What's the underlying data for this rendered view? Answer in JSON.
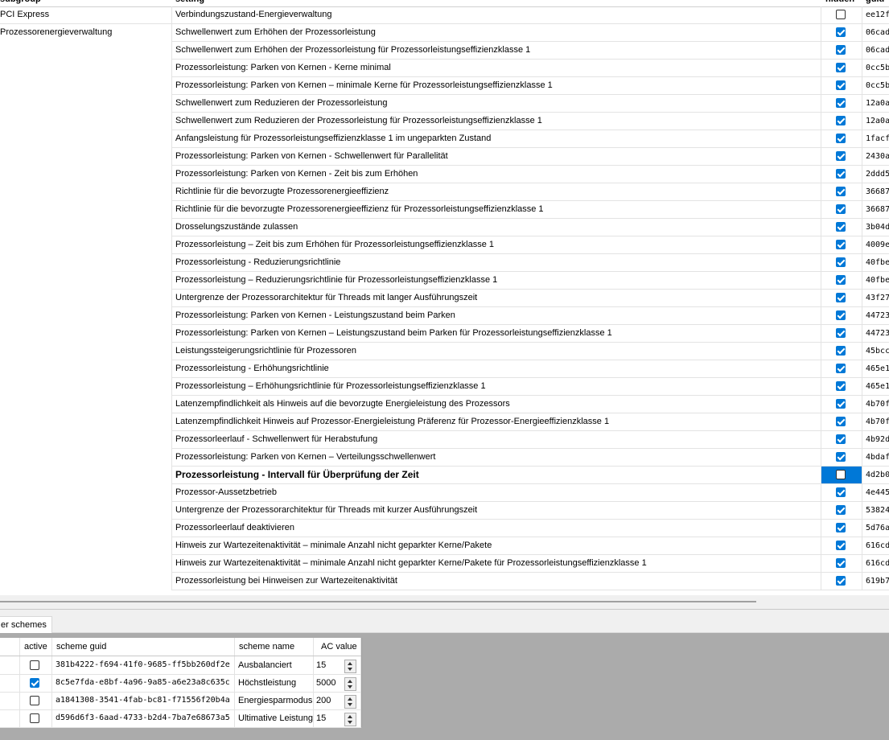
{
  "headers": {
    "subgroup": "subgroup",
    "setting": "setting",
    "hidden": "hidden",
    "guid": "guid"
  },
  "subgroups": [
    {
      "label": "PCI Express"
    },
    {
      "label": "Prozessorenergieverwaltung"
    }
  ],
  "rows": [
    {
      "setting": "Verbindungszustand-Energieverwaltung",
      "hidden": false,
      "guid": "ee12f"
    },
    {
      "setting": "Schwellenwert zum Erhöhen der Prozessorleistung",
      "hidden": true,
      "guid": "06cad"
    },
    {
      "setting": "Schwellenwert zum Erhöhen der Prozessorleistung für Prozessorleistungseffizienzklasse 1",
      "hidden": true,
      "guid": "06cad"
    },
    {
      "setting": "Prozessorleistung: Parken von Kernen - Kerne minimal",
      "hidden": true,
      "guid": "0cc5b"
    },
    {
      "setting": "Prozessorleistung: Parken von Kernen – minimale Kerne für Prozessorleistungseffizienzklasse 1",
      "hidden": true,
      "guid": "0cc5b"
    },
    {
      "setting": "Schwellenwert zum Reduzieren der Prozessorleistung",
      "hidden": true,
      "guid": "12a0a"
    },
    {
      "setting": "Schwellenwert zum Reduzieren der Prozessorleistung für Prozessorleistungseffizienzklasse 1",
      "hidden": true,
      "guid": "12a0a"
    },
    {
      "setting": "Anfangsleistung für Prozessorleistungseffizienzklasse 1 im ungeparkten Zustand",
      "hidden": true,
      "guid": "1facf"
    },
    {
      "setting": "Prozessorleistung: Parken von Kernen - Schwellenwert für Parallelität",
      "hidden": true,
      "guid": "2430a"
    },
    {
      "setting": "Prozessorleistung: Parken von Kernen - Zeit bis zum Erhöhen",
      "hidden": true,
      "guid": "2ddd5"
    },
    {
      "setting": "Richtlinie für die bevorzugte Prozessorenergieeffizienz",
      "hidden": true,
      "guid": "36687"
    },
    {
      "setting": "Richtlinie für die bevorzugte Prozessorenergieeffizienz für Prozessorleistungseffizienzklasse 1",
      "hidden": true,
      "guid": "36687"
    },
    {
      "setting": "Drosselungszustände zulassen",
      "hidden": true,
      "guid": "3b04d"
    },
    {
      "setting": "Prozessorleistung – Zeit bis zum Erhöhen für Prozessorleistungseffizienzklasse 1",
      "hidden": true,
      "guid": "4009e"
    },
    {
      "setting": "Prozessorleistung - Reduzierungsrichtlinie",
      "hidden": true,
      "guid": "40fbe"
    },
    {
      "setting": "Prozessorleistung – Reduzierungsrichtlinie für Prozessorleistungseffizienzklasse 1",
      "hidden": true,
      "guid": "40fbe"
    },
    {
      "setting": "Untergrenze der Prozessorarchitektur für Threads mit langer Ausführungszeit",
      "hidden": true,
      "guid": "43f27"
    },
    {
      "setting": "Prozessorleistung: Parken von Kernen - Leistungszustand beim Parken",
      "hidden": true,
      "guid": "44723"
    },
    {
      "setting": "Prozessorleistung: Parken von Kernen – Leistungszustand beim Parken für Prozessorleistungseffizienzklasse 1",
      "hidden": true,
      "guid": "44723"
    },
    {
      "setting": "Leistungssteigerungsrichtlinie für Prozessoren",
      "hidden": true,
      "guid": "45bcc"
    },
    {
      "setting": "Prozessorleistung - Erhöhungsrichtlinie",
      "hidden": true,
      "guid": "465e1"
    },
    {
      "setting": "Prozessorleistung – Erhöhungsrichtlinie für Prozessorleistungseffizienzklasse 1",
      "hidden": true,
      "guid": "465e1"
    },
    {
      "setting": "Latenzempfindlichkeit als Hinweis auf die bevorzugte Energieleistung des Prozessors",
      "hidden": true,
      "guid": "4b70f"
    },
    {
      "setting": "Latenzempfindlichkeit Hinweis auf Prozessor-Energieleistung Präferenz für Prozessor-Energieeffizienzklasse 1",
      "hidden": true,
      "guid": "4b70f"
    },
    {
      "setting": "Prozessorleerlauf - Schwellenwert für Herabstufung",
      "hidden": true,
      "guid": "4b92d"
    },
    {
      "setting": "Prozessorleistung: Parken von Kernen – Verteilungsschwellenwert",
      "hidden": true,
      "guid": "4bdaf"
    },
    {
      "setting": "Prozessorleistung - Intervall für Überprüfung der Zeit",
      "hidden": false,
      "guid": "4d2b0",
      "selected": true
    },
    {
      "setting": "Prozessor-Aussetzbetrieb",
      "hidden": true,
      "guid": "4e445"
    },
    {
      "setting": "Untergrenze der Prozessorarchitektur für Threads mit kurzer Ausführungszeit",
      "hidden": true,
      "guid": "53824"
    },
    {
      "setting": "Prozessorleerlauf deaktivieren",
      "hidden": true,
      "guid": "5d76a"
    },
    {
      "setting": "Hinweis zur Wartezeitenaktivität – minimale Anzahl nicht geparkter Kerne/Pakete",
      "hidden": true,
      "guid": "616cd"
    },
    {
      "setting": "Hinweis zur Wartezeitenaktivität – minimale Anzahl nicht geparkter Kerne/Pakete für Prozessorleistungseffizienzklasse 1",
      "hidden": true,
      "guid": "616cd"
    },
    {
      "setting": "Prozessorleistung bei Hinweisen zur Wartezeitenaktivität",
      "hidden": true,
      "guid": "619b7"
    }
  ],
  "tab": {
    "label": "er schemes"
  },
  "schemes": {
    "headers": {
      "active": "active",
      "guid": "scheme guid",
      "name": "scheme name",
      "ac": "AC value"
    },
    "rows": [
      {
        "active": false,
        "guid": "381b4222-f694-41f0-9685-ff5bb260df2e",
        "name": "Ausbalanciert",
        "ac": "15"
      },
      {
        "active": true,
        "guid": "8c5e7fda-e8bf-4a96-9a85-a6e23a8c635c",
        "name": "Höchstleistung",
        "ac": "5000"
      },
      {
        "active": false,
        "guid": "a1841308-3541-4fab-bc81-f71556f20b4a",
        "name": "Energiesparmodus",
        "ac": "200"
      },
      {
        "active": false,
        "guid": "d596d6f3-6aad-4733-b2d4-7ba7e68673a5",
        "name": "Ultimative Leistung",
        "ac": "15"
      }
    ]
  }
}
